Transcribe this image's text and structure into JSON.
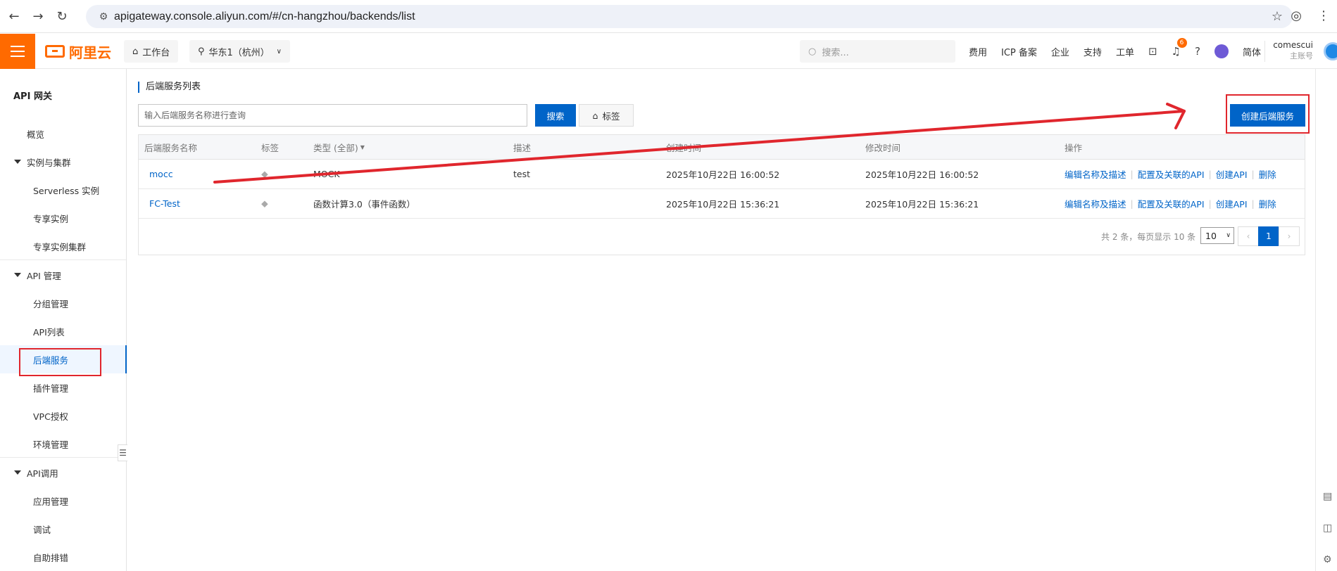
{
  "browser": {
    "url": "apigateway.console.aliyun.com/#/cn-hangzhou/backends/list"
  },
  "header": {
    "logo_text": "阿里云",
    "workbench": "工作台",
    "region": "华东1（杭州）",
    "search_placeholder": "搜索...",
    "links": [
      "费用",
      "ICP 备案",
      "企业",
      "支持",
      "工单"
    ],
    "notification_count": "6",
    "language": "简体",
    "user_name": "comescui",
    "user_role": "主账号"
  },
  "sidebar": {
    "title": "API 网关",
    "overview": "概览",
    "groups": [
      {
        "label": "实例与集群",
        "items": [
          "Serverless 实例",
          "专享实例",
          "专享实例集群"
        ]
      },
      {
        "label": "API 管理",
        "items": [
          "分组管理",
          "API列表",
          "后端服务",
          "插件管理",
          "VPC授权",
          "环境管理"
        ]
      },
      {
        "label": "API调用",
        "items": [
          "应用管理",
          "调试",
          "自助排错"
        ]
      }
    ],
    "active_item": "后端服务"
  },
  "main": {
    "title": "后端服务列表",
    "search_placeholder": "输入后端服务名称进行查询",
    "search_button": "搜索",
    "tag_button": "标签",
    "create_button": "创建后端服务",
    "columns": [
      "后端服务名称",
      "标签",
      "类型 (全部)",
      "描述",
      "创建时间",
      "修改时间",
      "操作"
    ],
    "rows": [
      {
        "name": "mocc",
        "type": "MOCK",
        "desc": "test",
        "created": "2025年10月22日 16:00:52",
        "modified": "2025年10月22日 16:00:52"
      },
      {
        "name": "FC-Test",
        "type": "函数计算3.0（事件函数）",
        "desc": "",
        "created": "2025年10月22日 15:36:21",
        "modified": "2025年10月22日 15:36:21"
      }
    ],
    "operations": [
      "编辑名称及描述",
      "配置及关联的API",
      "创建API",
      "删除"
    ],
    "pagination": {
      "summary": "共 2 条，每页显示 10 条",
      "page_size": "10",
      "current_page": "1",
      "prev": "‹",
      "next": "›"
    }
  },
  "colors": {
    "brand_orange": "#ff6a00",
    "primary_blue": "#0064c8",
    "annotation_red": "#e0262d"
  }
}
